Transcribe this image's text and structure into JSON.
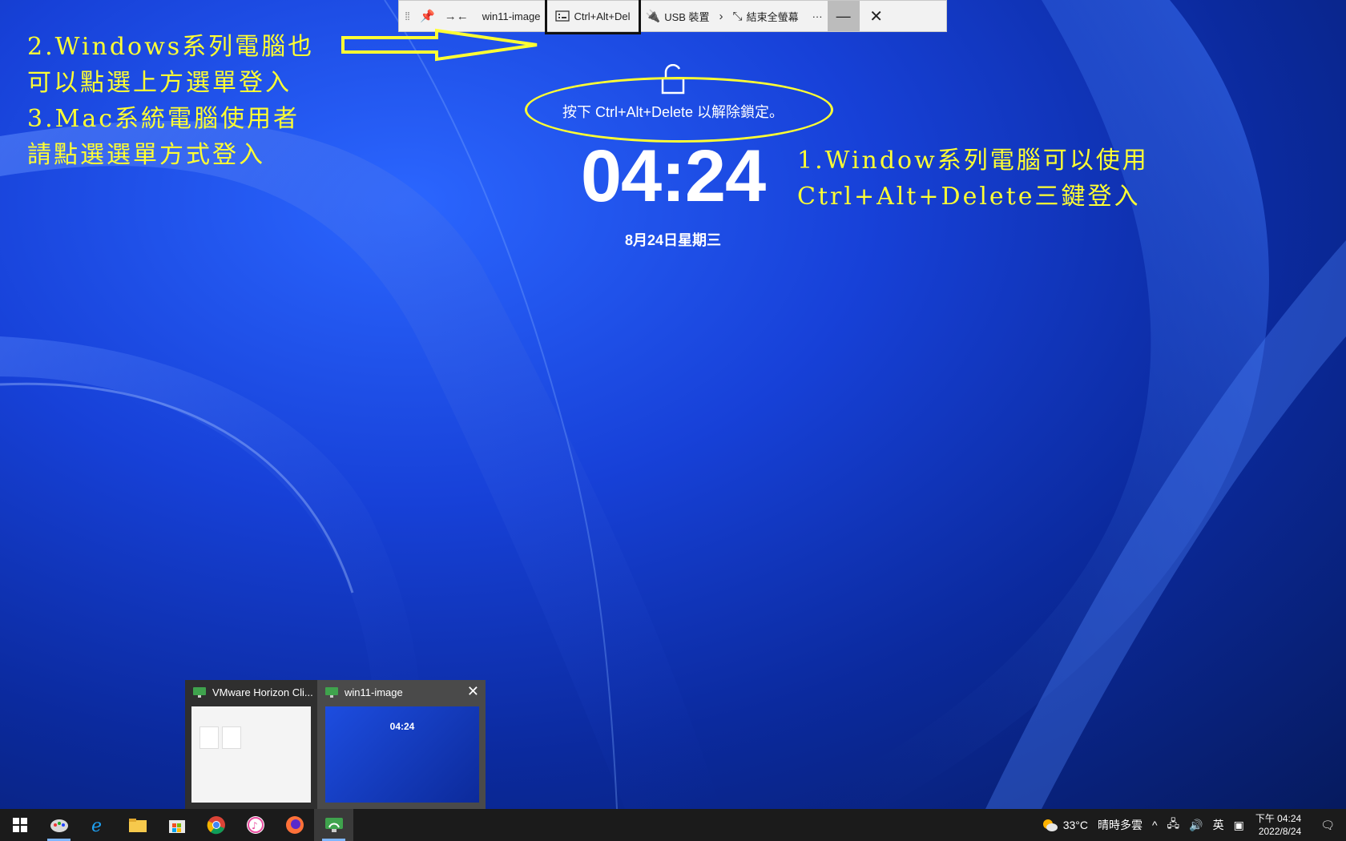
{
  "toolbar": {
    "desktop_name": "win11-image",
    "ctrl_alt_del_label": "Ctrl+Alt+Del",
    "usb_label": "USB 裝置",
    "exit_fullscreen_label": "結束全螢幕",
    "more_label": "···"
  },
  "lock_screen": {
    "unlock_prompt": "按下 Ctrl+Alt+Delete 以解除鎖定。",
    "time": "04:24",
    "date": "8月24日星期三"
  },
  "annotations": {
    "left_lines": [
      "2.Windows系列電腦也",
      "可以點選上方選單登入",
      "3.Mac系統電腦使用者",
      "請點選選單方式登入"
    ],
    "right_lines": [
      "1.Window系列電腦可以使用",
      "Ctrl+Alt+Delete三鍵登入"
    ],
    "color": "#ffff33"
  },
  "thumbnails": [
    {
      "title": "VMware Horizon Cli..."
    },
    {
      "title": "win11-image",
      "preview_time": "04:24"
    }
  ],
  "taskbar": {
    "apps": [
      "windows-start",
      "paint",
      "internet-explorer",
      "file-explorer",
      "microsoft-store",
      "chrome",
      "itunes",
      "firefox",
      "vmware-horizon"
    ]
  },
  "tray": {
    "weather_temp": "33°C",
    "weather_desc": "晴時多雲",
    "ime": "英",
    "time": "下午 04:24",
    "date": "2022/8/24"
  }
}
